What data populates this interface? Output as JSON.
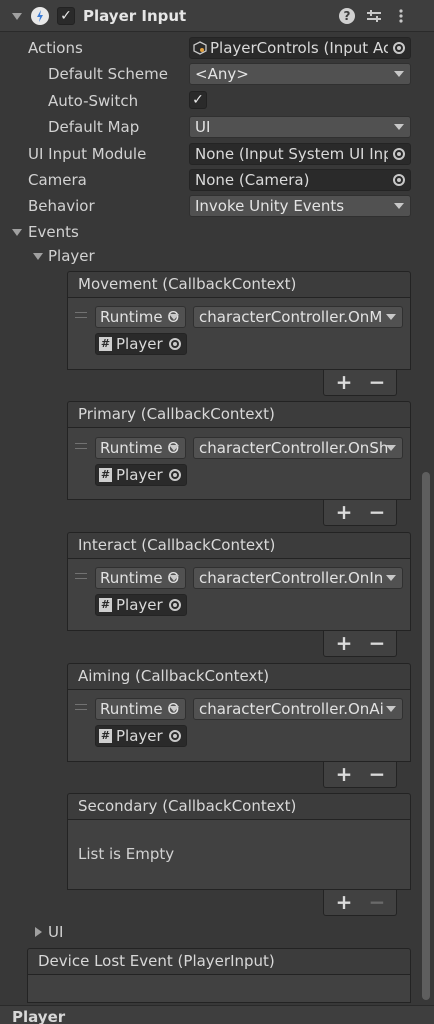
{
  "component": {
    "title": "Player Input",
    "enabled": true
  },
  "properties": {
    "actions_label": "Actions",
    "actions_value": "PlayerControls (Input Ac",
    "default_scheme_label": "Default Scheme",
    "default_scheme_value": "<Any>",
    "auto_switch_label": "Auto-Switch",
    "auto_switch_checked": true,
    "default_map_label": "Default Map",
    "default_map_value": "UI",
    "ui_input_module_label": "UI Input Module",
    "ui_input_module_value": "None (Input System UI Inpu",
    "camera_label": "Camera",
    "camera_value": "None (Camera)",
    "behavior_label": "Behavior",
    "behavior_value": "Invoke Unity Events"
  },
  "events": {
    "label": "Events",
    "player_group": "Player",
    "ui_group": "UI",
    "list": [
      {
        "header": "Movement (CallbackContext)",
        "runtime": "Runtime O",
        "function": "characterController.OnM",
        "object": "Player"
      },
      {
        "header": "Primary (CallbackContext)",
        "runtime": "Runtime O",
        "function": "characterController.OnSh",
        "object": "Player"
      },
      {
        "header": "Interact (CallbackContext)",
        "runtime": "Runtime O",
        "function": "characterController.OnIn",
        "object": "Player"
      },
      {
        "header": "Aiming (CallbackContext)",
        "runtime": "Runtime O",
        "function": "characterController.OnAi",
        "object": "Player"
      }
    ],
    "secondary": {
      "header": "Secondary (CallbackContext)",
      "empty_text": "List is Empty"
    },
    "device_lost": "Device Lost Event (PlayerInput)"
  },
  "footer": {
    "label": "Player"
  },
  "icons": {
    "plus": "+",
    "minus": "−",
    "hash": "#",
    "check": "✓"
  }
}
